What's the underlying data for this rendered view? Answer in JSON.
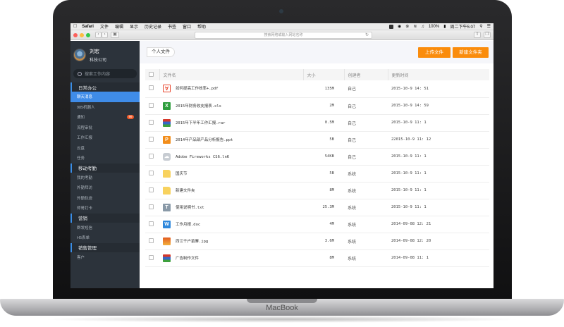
{
  "device": {
    "brand": "MacBook"
  },
  "menubar": {
    "items": [
      "Safari",
      "文件",
      "编辑",
      "显示",
      "历史记录",
      "书签",
      "窗口",
      "帮助"
    ],
    "battery": "100%",
    "clock": "周二下午5:07"
  },
  "browser": {
    "address_placeholder": "搜索网络或输入网站名称"
  },
  "profile": {
    "name": "刘宏",
    "company": "科技公司"
  },
  "sidebar": {
    "search_placeholder": "搜索工作内容",
    "groups": [
      {
        "label": "日常办公",
        "items": [
          "聊天消息",
          "985机器人",
          "通知",
          "流程审批",
          "工作汇报",
          "云盘",
          "任务"
        ]
      },
      {
        "label": "移动考勤",
        "items": [
          "我的考勤",
          "外勤拜访",
          "外勤轨迹",
          "师哥打卡"
        ]
      },
      {
        "label": "营销",
        "items": [
          "群发短信",
          "H5表单"
        ]
      },
      {
        "label": "销售管理",
        "items": [
          "客户"
        ]
      }
    ],
    "notice_badge": "99",
    "active_item": "聊天消息",
    "colors": {
      "background": "#2c333b",
      "active": "#3f8ce8",
      "badge": "#f05a28"
    }
  },
  "topbar": {
    "breadcrumb": "个人文件",
    "upload_button": "上传文件",
    "new_folder_button": "新建文件夹",
    "accent": "#fa8c0c"
  },
  "table": {
    "headers": [
      "文件名",
      "大小",
      "创建者",
      "更新时间"
    ],
    "rows": [
      {
        "icon": "pdf-icon",
        "name": "如何提高工作效率+.pdf",
        "size": "135M",
        "creator": "自己",
        "updated": "2015-10-9 14: 51"
      },
      {
        "icon": "excel-icon",
        "name": "2015年财务收支报表.xls",
        "size": "2M",
        "creator": "自己",
        "updated": "2015-10-9 14: 59"
      },
      {
        "icon": "rar-icon",
        "name": "2015年下半年工作汇报.rar",
        "size": "0.5M",
        "creator": "自己",
        "updated": "2015-10-9 11: 1"
      },
      {
        "icon": "ppt-icon",
        "name": "2014年产品部产品分析报告.ppt",
        "size": "5B",
        "creator": "自己",
        "updated": "22015-10-9 11: 12"
      },
      {
        "icon": "link-icon",
        "name": "Adobe Fireworks CS6.lnK",
        "size": "54KB",
        "creator": "自己",
        "updated": "2015-10-9 11: 1"
      },
      {
        "icon": "folder-icon",
        "name": "国庆节",
        "size": "5B",
        "creator": "系统",
        "updated": "2015-10-9 11: 1"
      },
      {
        "icon": "folder-icon",
        "name": "新建文件夹",
        "size": "8M",
        "creator": "系统",
        "updated": "2015-10-9 11: 1"
      },
      {
        "icon": "txt-icon",
        "name": "使用说明书.txt",
        "size": "25.3M",
        "creator": "系统",
        "updated": "2015-10-9 11: 1"
      },
      {
        "icon": "word-icon",
        "name": "工作月报.doc",
        "size": "4M",
        "creator": "系统",
        "updated": "2014-09-08 12: 21"
      },
      {
        "icon": "image-icon",
        "name": "西江千户苗寨.jpg",
        "size": "3.6M",
        "creator": "系统",
        "updated": "2014-09-08 12: 20"
      },
      {
        "icon": "rar-icon",
        "name": "广告制作文件",
        "size": "8M",
        "creator": "系统",
        "updated": "2014-09-08 11: 1"
      }
    ]
  }
}
